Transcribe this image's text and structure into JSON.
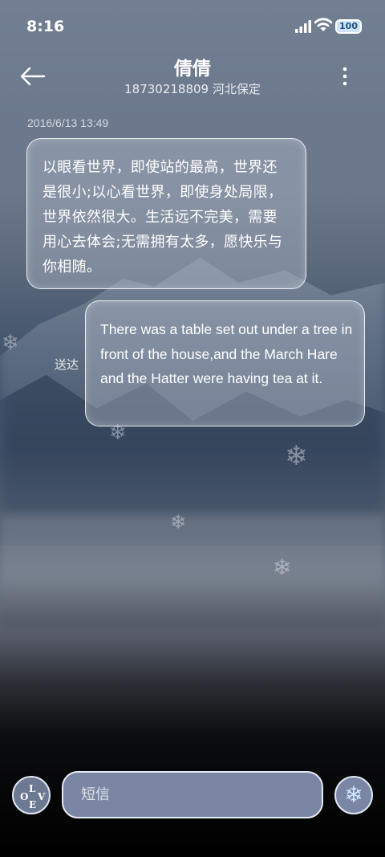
{
  "status_bar": {
    "time": "8:16",
    "battery": "100"
  },
  "header": {
    "title": "倩倩",
    "subtitle": "18730218809 河北保定"
  },
  "conversation": {
    "timestamp": "2016/6/13 13:49",
    "received_message": "以眼看世界，即使站的最高，世界还是很小;以心看世界，即使身处局限，世界依然很大。生活远不完美，需要用心去体会;无需拥有太多，愿快乐与你相随。",
    "sent_label": "送达",
    "sent_message": "There was a table set out under a tree in front of the house,and the March Hare and the Hatter were having tea at it."
  },
  "compose": {
    "placeholder": "短信",
    "love_letters": [
      "L",
      "O",
      "V",
      "E"
    ]
  },
  "icons": {
    "back": "arrow-left-icon",
    "more": "vertical-dots-icon",
    "send": "snowflake-icon"
  },
  "colors": {
    "bubble_border": "#ffffff",
    "input_bg": "#7a86a4"
  }
}
